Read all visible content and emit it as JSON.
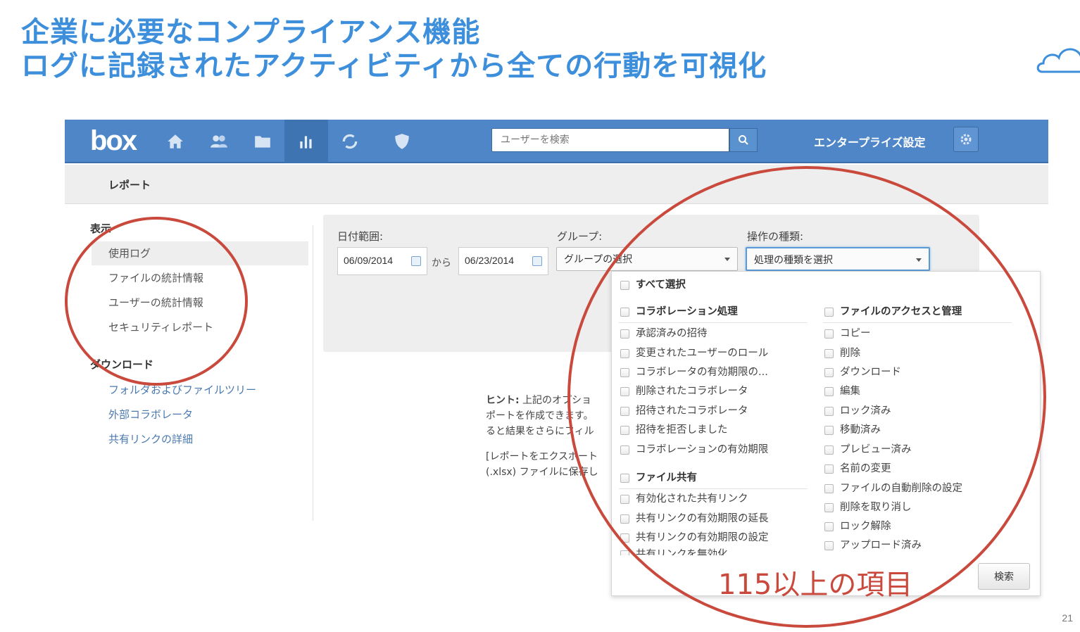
{
  "slide": {
    "title_line1": "企業に必要なコンプライアンス機能",
    "title_line2": "ログに記録されたアクティビティから全ての行動を可視化",
    "page_number": "21",
    "cloud_icon": "cloud-icon",
    "title_color": "#3d8fdc"
  },
  "topbar": {
    "logo": "box",
    "nav_icons": [
      "home-icon",
      "users-icon",
      "folder-icon",
      "reports-icon",
      "sync-icon",
      "shield-icon"
    ],
    "active_nav": "reports-icon",
    "search_placeholder": "ユーザーを検索",
    "enterprise_settings": "エンタープライズ設定",
    "bar_color": "#4e86c7"
  },
  "subbar": {
    "page_title": "レポート"
  },
  "sidebar": {
    "view_heading": "表示",
    "view_items": [
      "使用ログ",
      "ファイルの統計情報",
      "ユーザーの統計情報",
      "セキュリティレポート"
    ],
    "active_item": "使用ログ",
    "download_heading": "ダウンロード",
    "download_links": [
      "フォルダおよびファイルツリー",
      "外部コラボレータ",
      "共有リンクの詳細"
    ]
  },
  "filters": {
    "date_range_label": "日付範囲:",
    "date_from": "06/09/2014",
    "from_text": "から",
    "date_to": "06/23/2014",
    "group_label": "グループ:",
    "group_select": "グループの選択",
    "action_type_label": "操作の種類:",
    "action_type_select": "処理の種類を選択"
  },
  "hint": {
    "label": "ヒント:",
    "line1": "上記のオプショ",
    "line2": "ポートを作成できます。",
    "line3": "ると結果をさらにフィル",
    "line4": "[レポートをエクスポート",
    "line5": "(.xlsx) ファイルに保存し"
  },
  "dropdown": {
    "select_all": "すべて選択",
    "collab_heading": "コラボレーション処理",
    "collab_items": [
      "承認済みの招待",
      "変更されたユーザーのロール",
      "コラボレータの有効期限の...",
      "削除されたコラボレータ",
      "招待されたコラボレータ",
      "招待を拒否しました",
      "コラボレーションの有効期限"
    ],
    "share_heading": "ファイル共有",
    "share_items": [
      "有効化された共有リンク",
      "共有リンクの有効期限の延長",
      "共有リンクの有効期限の設定",
      "共有リンクを無効化"
    ],
    "file_heading": "ファイルのアクセスと管理",
    "file_items": [
      "コピー",
      "削除",
      "ダウンロード",
      "編集",
      "ロック済み",
      "移動済み",
      "プレビュー済み",
      "名前の変更",
      "ファイルの自動削除の設定",
      "削除を取り消し",
      "ロック解除",
      "アップロード済み"
    ],
    "search_button": "検索"
  },
  "annotation": {
    "text": "115以上の項目",
    "color": "#c94a3d"
  }
}
